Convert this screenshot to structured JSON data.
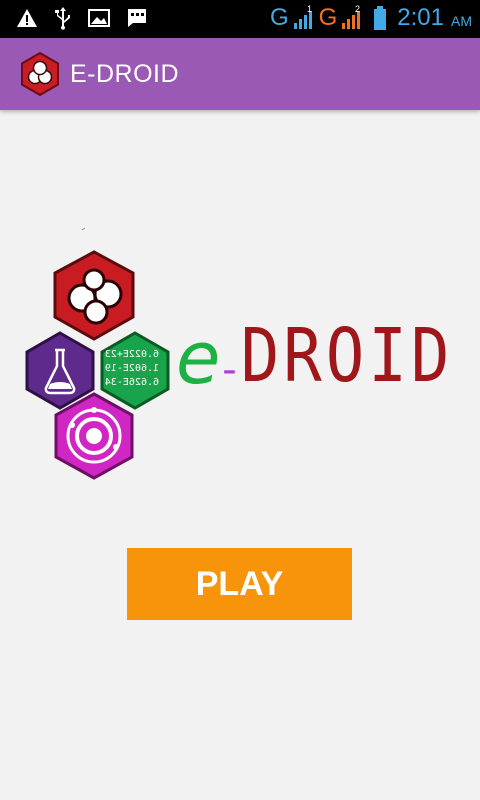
{
  "status_bar": {
    "network1": "G",
    "network2": "G",
    "sim1_index": "1",
    "sim2_index": "2",
    "time": "2:01",
    "ampm": "AM",
    "icons": [
      "warning-icon",
      "usb-icon",
      "image-icon",
      "message-icon",
      "signal-icon",
      "battery-icon"
    ],
    "colors": {
      "sim1": "#41a9e5",
      "sim2": "#f0721c",
      "time": "#41a9e5"
    }
  },
  "app_bar": {
    "title": "E-DROID",
    "color": "#9a59b5"
  },
  "brand": {
    "e": "e",
    "dash": "-",
    "droid": "DROID",
    "hex_texts": [
      "6.022E+23",
      "1.602E-19",
      "6.626E-34"
    ],
    "colors": {
      "e": "#1db043",
      "dash": "#b43bd8",
      "droid": "#a0171b"
    }
  },
  "main": {
    "play_label": "PLAY",
    "play_color": "#f8940a"
  }
}
